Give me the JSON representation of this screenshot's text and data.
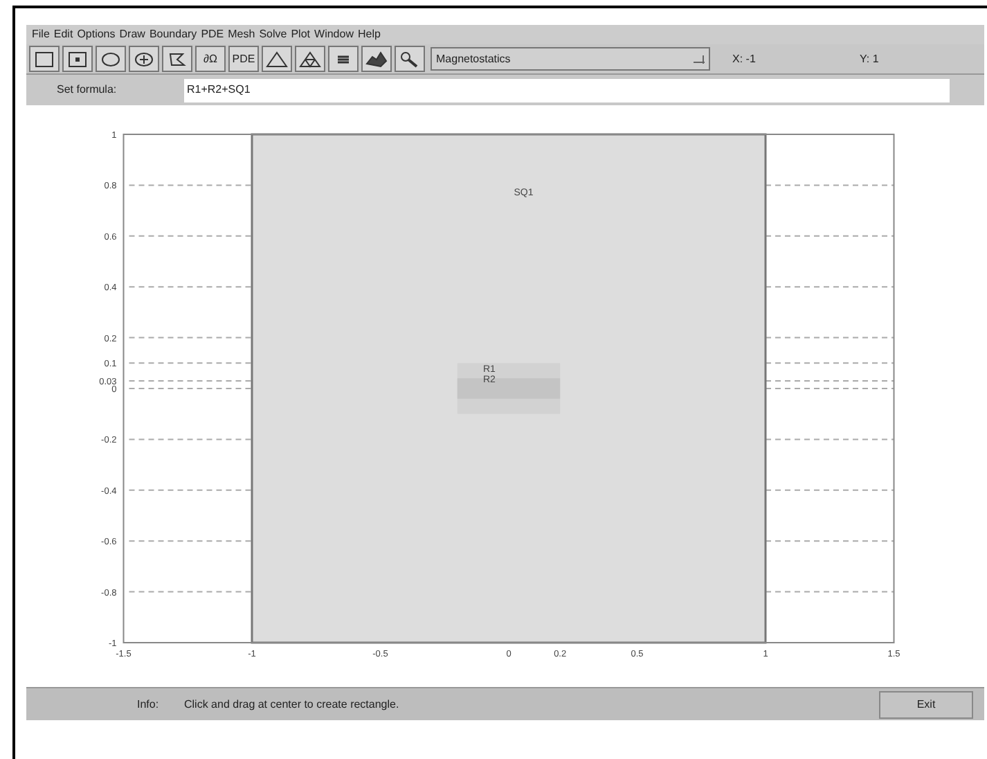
{
  "menu": [
    "File",
    "Edit",
    "Options",
    "Draw",
    "Boundary",
    "PDE",
    "Mesh",
    "Solve",
    "Plot",
    "Window",
    "Help"
  ],
  "toolbar": [
    {
      "kind": "rectangle"
    },
    {
      "kind": "rectcenter"
    },
    {
      "kind": "ellipse"
    },
    {
      "kind": "ellipsecenter"
    },
    {
      "kind": "polygon"
    },
    {
      "kind": "text",
      "label": "∂Ω"
    },
    {
      "kind": "text",
      "label": "PDE"
    },
    {
      "kind": "triangle"
    },
    {
      "kind": "refine"
    },
    {
      "kind": "bars"
    },
    {
      "kind": "surface"
    },
    {
      "kind": "zoom"
    }
  ],
  "mode": {
    "value": "Magnetostatics"
  },
  "x_readout": "X: -1",
  "y_readout": "Y: 1",
  "formula": {
    "label": "Set formula:",
    "value": "R1+R2+SQ1"
  },
  "plot": {
    "xticks": [
      "-1.5",
      "-1",
      "-0.5",
      "0",
      "0.2",
      "0.5",
      "1",
      "1.5"
    ],
    "yticks": [
      "1",
      "0.8",
      "0.6",
      "0.4",
      "0.2",
      "0.1",
      "0.03",
      "0",
      "-0.2",
      "-0.4",
      "-0.6",
      "-0.8",
      "-1"
    ],
    "shapes": [
      {
        "label": "SQ1"
      },
      {
        "label": "R1"
      },
      {
        "label": "R2"
      }
    ]
  },
  "info": {
    "label": "Info:",
    "text": "Click and drag at center to create rectangle."
  },
  "exit_button": "Exit"
}
